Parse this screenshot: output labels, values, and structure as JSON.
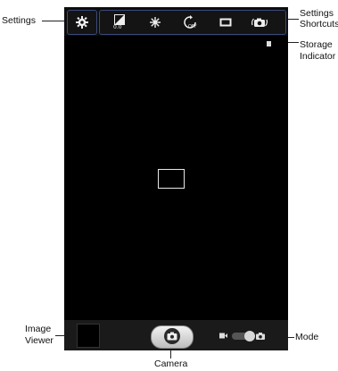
{
  "callouts": {
    "settings": "Settings",
    "settings_shortcuts_line1": "Settings",
    "settings_shortcuts_line2": "Shortcuts",
    "storage_line1": "Storage",
    "storage_line2": "Indicator",
    "image_viewer_line1": "Image",
    "image_viewer_line2": "Viewer",
    "mode": "Mode",
    "camera": "Camera"
  },
  "shortcut_icons": [
    "exposure-icon",
    "flash-icon",
    "timer-off-icon",
    "aspect-ratio-icon",
    "camera-switch-icon"
  ],
  "exposure_value": "0.0",
  "timer_badge": "OFF",
  "colors": {
    "viewfinder": "#000000",
    "toolbar_border": "#3a4a7a",
    "callout_text": "#111111"
  }
}
